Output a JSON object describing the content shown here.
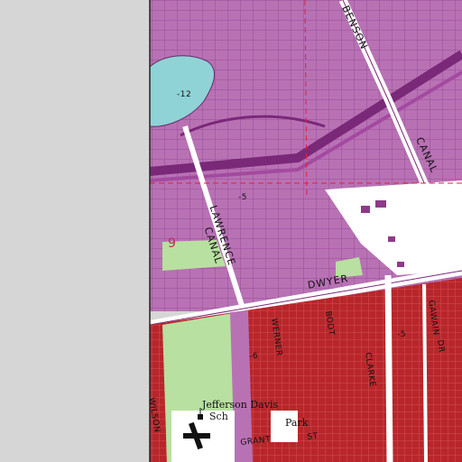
{
  "map": {
    "colors": {
      "margin": "#d6d6d6",
      "urban": "#b872b4",
      "urban_dark": "#8e3a8a",
      "dense_red": "#b8262b",
      "red_line": "#e4a0a0",
      "water": "#8fd3d6",
      "green": "#b8e0a0",
      "white": "#ffffff",
      "road": "#7a2878",
      "section_line": "#e02040"
    },
    "labels": {
      "benson": "BENSON",
      "canal_right": "CANAL",
      "lawrence": "LAWRENCE",
      "canal_left": "CANAL",
      "dwyer": "DWYER",
      "wilson": "WILSON",
      "werner": "WERNER",
      "bodt": "BODT",
      "clarke": "CLARKE",
      "gawain": "GAWAIN",
      "dr": "DR",
      "grant": "GRANT",
      "st": "ST",
      "jefferson_davis": "Jefferson Davis",
      "sch": "Sch",
      "park": "Park",
      "elev_12": "-12",
      "elev_6": "-6",
      "elev_5": "-5",
      "elev_5b": "-5",
      "section_9": "9"
    },
    "icons": [
      "school-icon",
      "airstrip-cross-icon"
    ]
  }
}
